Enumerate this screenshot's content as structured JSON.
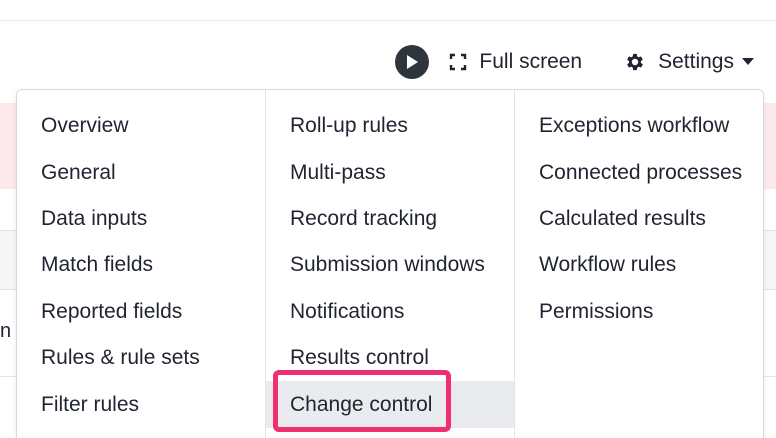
{
  "toolbar": {
    "play_icon": "play-icon",
    "fullscreen_label": "Full screen",
    "fullscreen_icon": "fullscreen-icon",
    "settings_label": "Settings",
    "settings_icon": "gear-icon",
    "caret_icon": "caret-down-icon"
  },
  "background": {
    "fragment_text": "n"
  },
  "menu": {
    "columns": [
      {
        "items": [
          {
            "label": "Overview"
          },
          {
            "label": "General"
          },
          {
            "label": "Data inputs"
          },
          {
            "label": "Match fields"
          },
          {
            "label": "Reported fields"
          },
          {
            "label": "Rules & rule sets"
          },
          {
            "label": "Filter rules"
          }
        ]
      },
      {
        "items": [
          {
            "label": "Roll-up rules"
          },
          {
            "label": "Multi-pass"
          },
          {
            "label": "Record tracking"
          },
          {
            "label": "Submission windows"
          },
          {
            "label": "Notifications"
          },
          {
            "label": "Results control"
          },
          {
            "label": "Change control",
            "highlighted": true
          }
        ]
      },
      {
        "items": [
          {
            "label": "Exceptions workflow"
          },
          {
            "label": "Connected processes"
          },
          {
            "label": "Calculated results"
          },
          {
            "label": "Workflow rules"
          },
          {
            "label": "Permissions"
          }
        ]
      }
    ]
  },
  "colors": {
    "highlight_outline": "#f0306e",
    "highlight_fill": "#e9ebee",
    "alert_band": "#fbe9ec"
  }
}
